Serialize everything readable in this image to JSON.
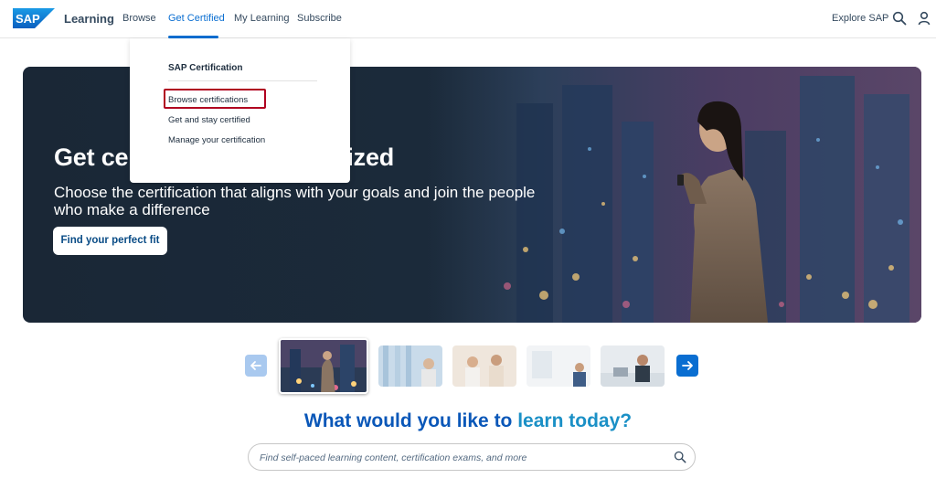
{
  "header": {
    "brand": "Learning",
    "nav": [
      {
        "label": "Browse"
      },
      {
        "label": "Get Certified"
      },
      {
        "label": "My Learning"
      },
      {
        "label": "Subscribe"
      }
    ],
    "explore_label": "Explore SAP",
    "logo_text": "SAP"
  },
  "dropdown": {
    "title": "SAP Certification",
    "items": [
      {
        "label": "Browse certifications"
      },
      {
        "label": "Get and stay certified"
      },
      {
        "label": "Manage your certification"
      }
    ]
  },
  "hero": {
    "title_part1": "Get ce",
    "title_part2": "ized",
    "subtitle": "Choose the certification that aligns with your goals and join the people who make a difference",
    "cta": "Find your perfect fit"
  },
  "search": {
    "heading_part1": "What would you like to ",
    "heading_part2": "learn today?",
    "placeholder": "Find self-paced learning content, certification exams, and more"
  },
  "colors": {
    "accent": "#0a6ed1",
    "hero_bg": "#1a2736",
    "highlight": "#b00020"
  }
}
